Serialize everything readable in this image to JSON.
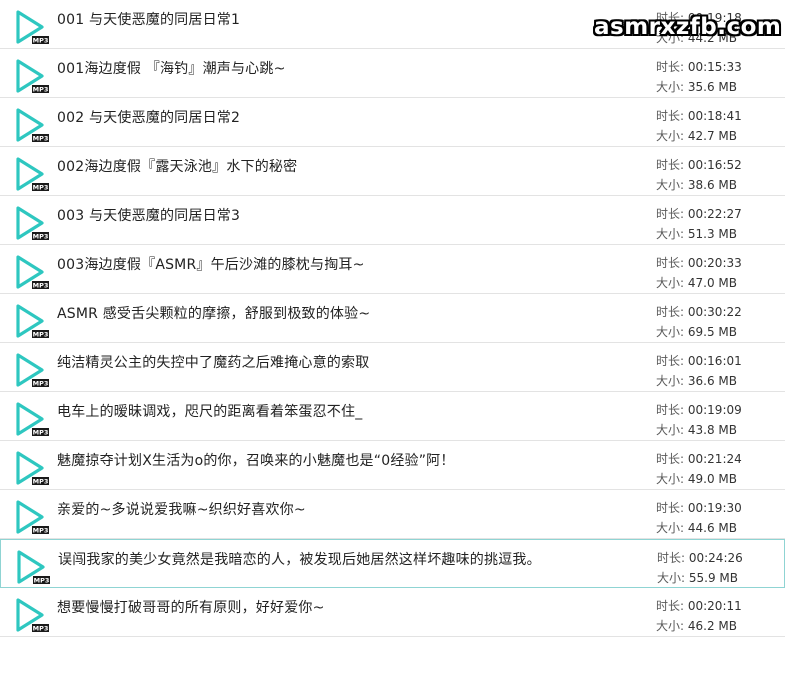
{
  "watermark": "asmrxzfb.com",
  "labels": {
    "duration": "时长: ",
    "size": "大小: "
  },
  "icon_badge": "MP3",
  "accent_color": "#2ec7c0",
  "items": [
    {
      "title": "001 与天使恶魔的同居日常1",
      "duration": "00:19:18",
      "size": "44.2 MB"
    },
    {
      "title": "001海边度假 『海钓』潮声与心跳~",
      "duration": "00:15:33",
      "size": "35.6 MB"
    },
    {
      "title": "002 与天使恶魔的同居日常2",
      "duration": "00:18:41",
      "size": "42.7 MB"
    },
    {
      "title": "002海边度假『露天泳池』水下的秘密",
      "duration": "00:16:52",
      "size": "38.6 MB"
    },
    {
      "title": "003 与天使恶魔的同居日常3",
      "duration": "00:22:27",
      "size": "51.3 MB"
    },
    {
      "title": "003海边度假『ASMR』午后沙滩的膝枕与掏耳~",
      "duration": "00:20:33",
      "size": "47.0 MB"
    },
    {
      "title": "ASMR 感受舌尖颗粒的摩擦，舒服到极致的体验~",
      "duration": "00:30:22",
      "size": "69.5 MB"
    },
    {
      "title": "纯洁精灵公主的失控中了魔药之后难掩心意的索取",
      "duration": "00:16:01",
      "size": "36.6 MB"
    },
    {
      "title": "电车上的暧昧调戏，咫尺的距离看着笨蛋忍不住_",
      "duration": "00:19:09",
      "size": "43.8 MB"
    },
    {
      "title": "魅魔掠夺计划X生活为o的你，召唤来的小魅魔也是“0经验”阿！",
      "duration": "00:21:24",
      "size": "49.0 MB"
    },
    {
      "title": "亲爱的~多说说爱我嘛~织织好喜欢你~",
      "duration": "00:19:30",
      "size": "44.6 MB"
    },
    {
      "title": "误闯我家的美少女竟然是我暗恋的人，被发现后她居然这样坏趣味的挑逗我。",
      "duration": "00:24:26",
      "size": "55.9 MB",
      "selected": true
    },
    {
      "title": "想要慢慢打破哥哥的所有原则，好好爱你~",
      "duration": "00:20:11",
      "size": "46.2 MB"
    }
  ]
}
